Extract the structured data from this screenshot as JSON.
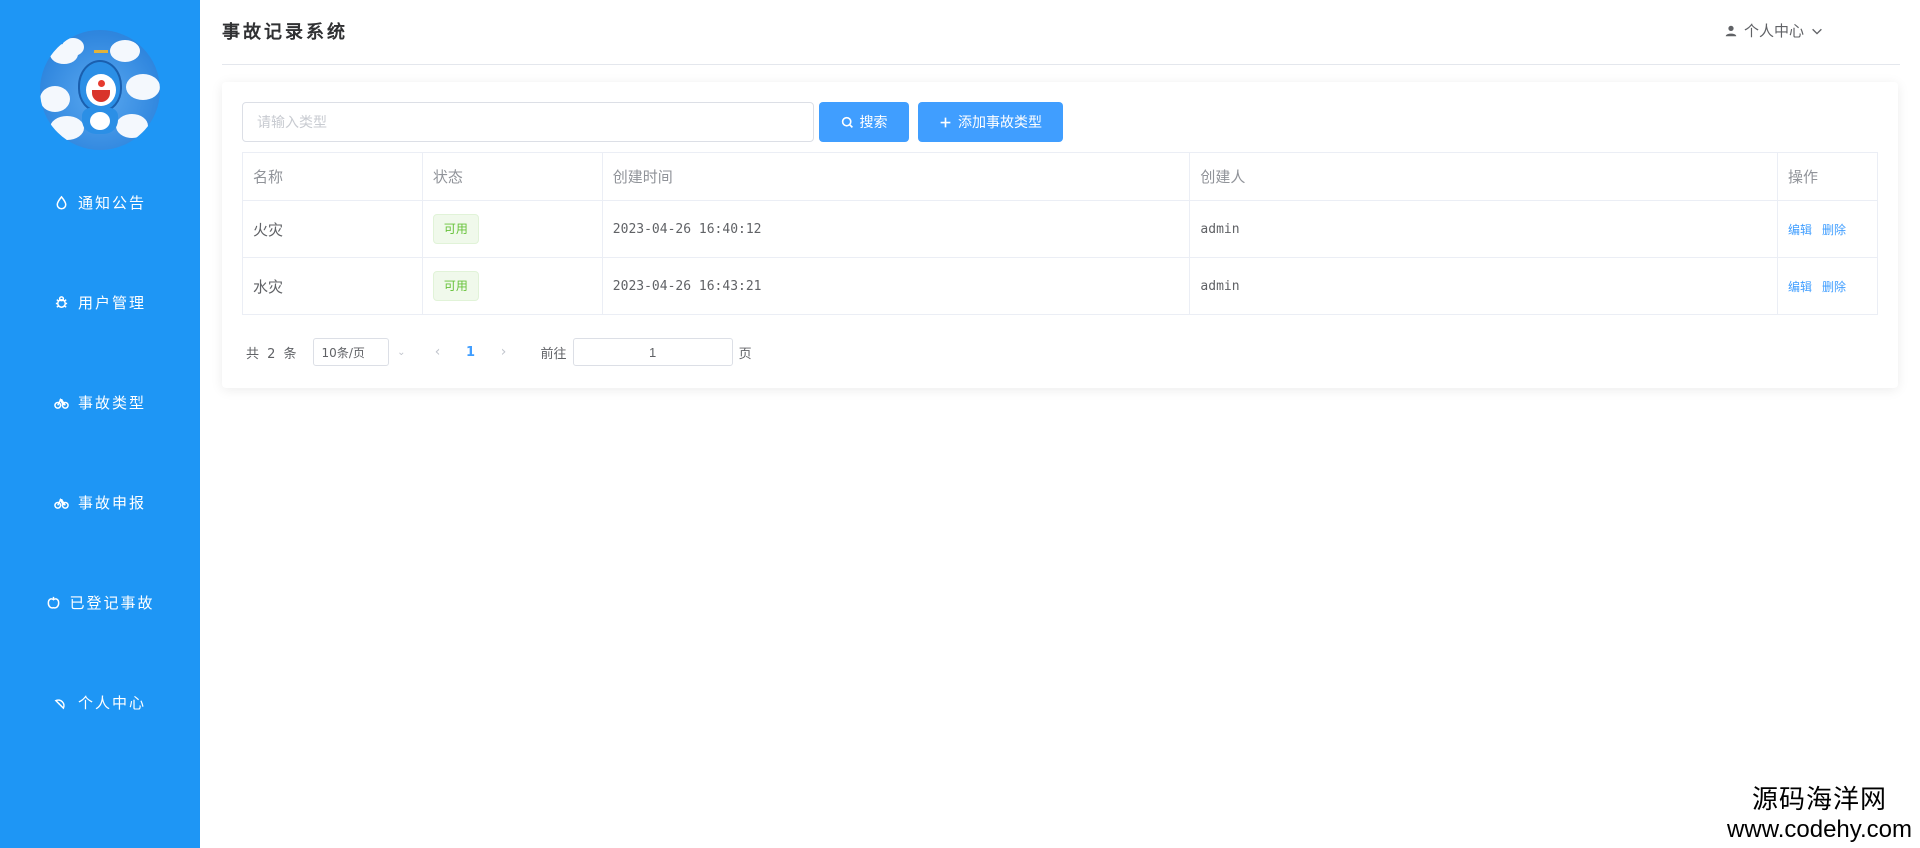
{
  "app": {
    "title": "事故记录系统"
  },
  "header": {
    "user_center": "个人中心"
  },
  "sidebar": {
    "items": [
      {
        "label": "通知公告",
        "icon": "drop-icon"
      },
      {
        "label": "用户管理",
        "icon": "bug-icon"
      },
      {
        "label": "事故类型",
        "icon": "bicycle-icon"
      },
      {
        "label": "事故申报",
        "icon": "bicycle-icon"
      },
      {
        "label": "已登记事故",
        "icon": "apple-icon"
      },
      {
        "label": "个人中心",
        "icon": "watermelon-icon"
      }
    ]
  },
  "toolbar": {
    "search_placeholder": "请输入类型",
    "search_label": "搜索",
    "add_label": "添加事故类型"
  },
  "table": {
    "columns": [
      "名称",
      "状态",
      "创建时间",
      "创建人",
      "操作"
    ],
    "rows": [
      {
        "name": "火灾",
        "status": "可用",
        "created_at": "2023-04-26 16:40:12",
        "creator": "admin",
        "edit": "编辑",
        "delete": "删除"
      },
      {
        "name": "水灾",
        "status": "可用",
        "created_at": "2023-04-26 16:43:21",
        "creator": "admin",
        "edit": "编辑",
        "delete": "删除"
      }
    ]
  },
  "pagination": {
    "total_text": "共 2 条",
    "page_size": "10条/页",
    "current_page": "1",
    "goto_label": "前往",
    "jump_value": "1",
    "page_suffix": "页"
  },
  "watermark": {
    "cn": "源码海洋网",
    "en": "www.codehy.com"
  },
  "colors": {
    "sidebar": "#1e96f5",
    "primary": "#409eff",
    "success": "#67c23a"
  }
}
